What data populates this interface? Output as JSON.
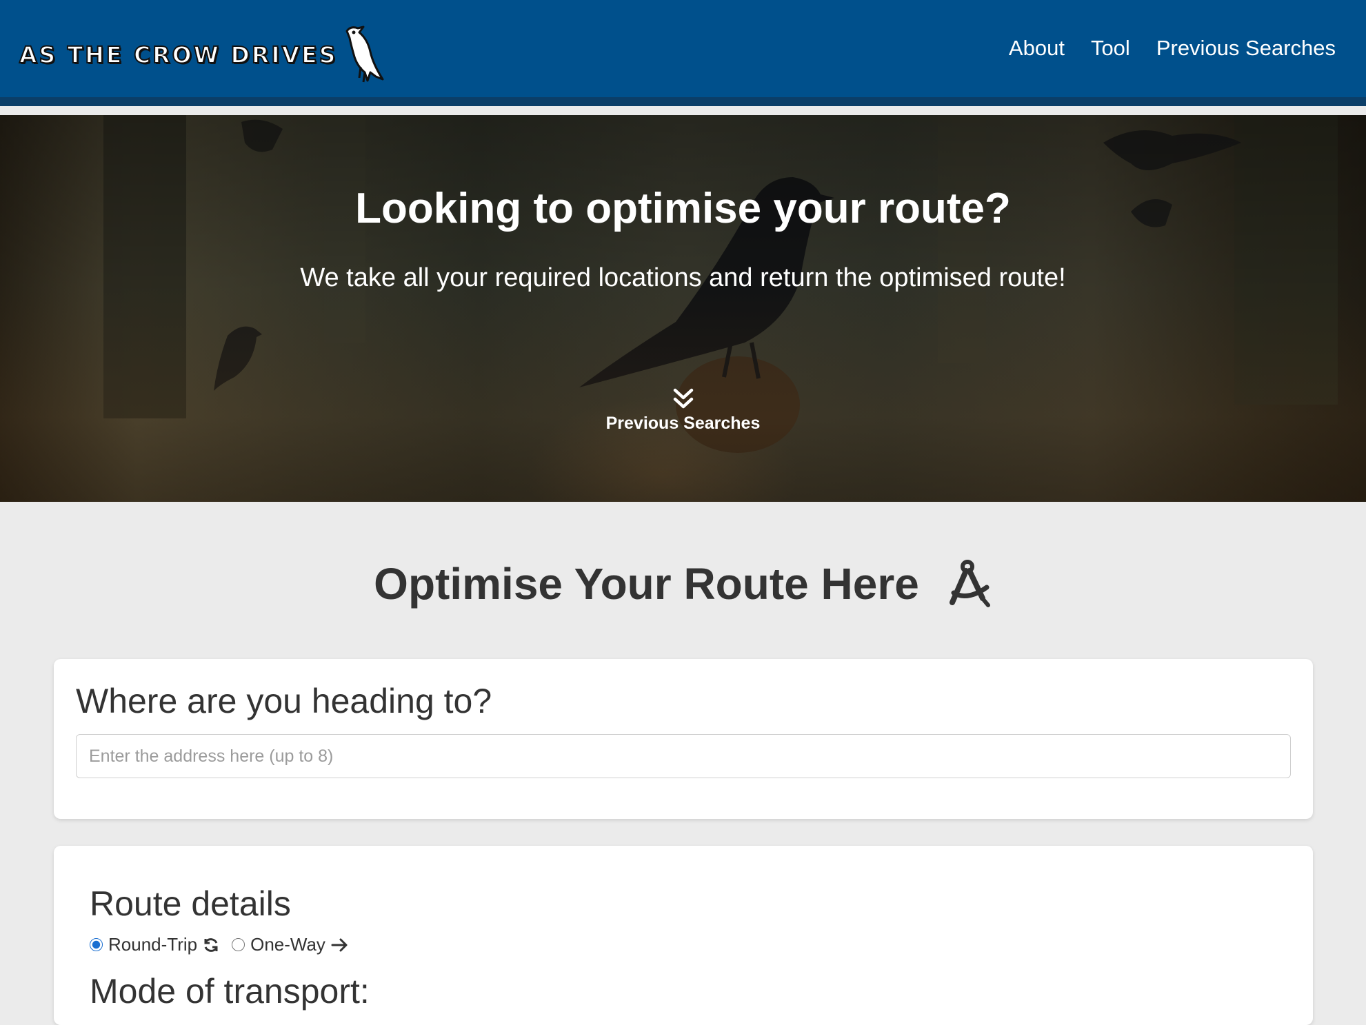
{
  "header": {
    "brand_text": "AS THE CROW DRIVES",
    "nav": [
      {
        "label": "About"
      },
      {
        "label": "Tool"
      },
      {
        "label": "Previous Searches"
      }
    ]
  },
  "hero": {
    "title": "Looking to optimise your route?",
    "subtitle": "We take all your required locations and return the optimised route!",
    "scroll_label": "Previous Searches"
  },
  "tool": {
    "section_title": "Optimise Your Route Here",
    "destination": {
      "heading": "Where are you heading to?",
      "placeholder": "Enter the address here (up to 8)",
      "value": ""
    },
    "route_details": {
      "heading": "Route details",
      "options": [
        {
          "label": "Round-Trip",
          "selected": true,
          "icon": "refresh-icon"
        },
        {
          "label": "One-Way",
          "selected": false,
          "icon": "arrow-right-icon"
        }
      ],
      "mode_heading": "Mode of transport:"
    }
  },
  "colors": {
    "navbar": "#00508c",
    "navbar_border": "#0b3e68",
    "page_background": "#ebebeb",
    "card_background": "#ffffff",
    "text": "#333333",
    "radio_accent": "#1a6fd1"
  }
}
